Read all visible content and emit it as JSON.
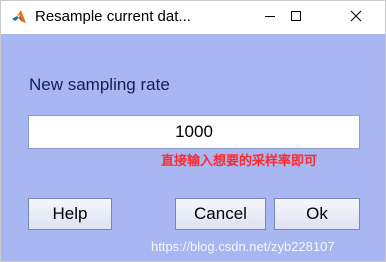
{
  "window": {
    "title": "Resample current dat..."
  },
  "titlebar_buttons": {
    "minimize_icon": "minimize-icon",
    "maximize_icon": "maximize-icon",
    "close_icon": "close-icon"
  },
  "dialog": {
    "prompt": "New sampling rate",
    "input_value": "1000",
    "annotation": "直接输入想要的采样率即可",
    "buttons": {
      "help": "Help",
      "cancel": "Cancel",
      "ok": "Ok"
    },
    "watermark": "https://blog.csdn.net/zyb228107"
  },
  "colors": {
    "client_background": "#a8b6f2",
    "annotation": "#ff2a2a"
  },
  "icons": {
    "app": "matlab-logo-icon"
  }
}
